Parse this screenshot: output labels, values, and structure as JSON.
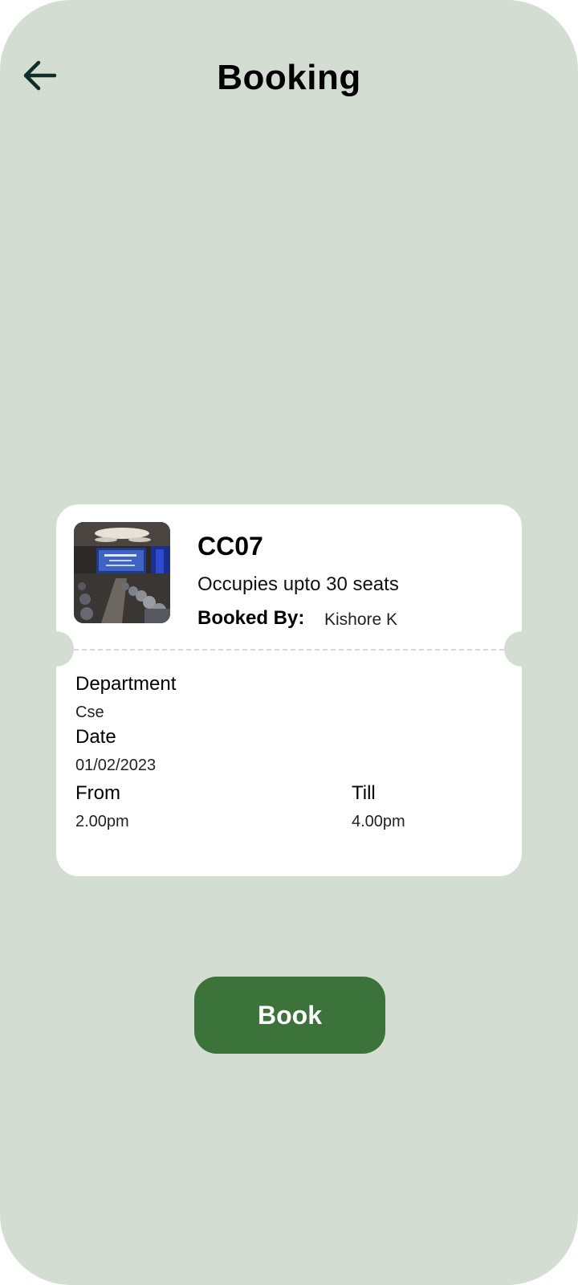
{
  "header": {
    "title": "Booking",
    "back_icon": "arrow-left-icon"
  },
  "booking_card": {
    "room_code": "CC07",
    "capacity_text": "Occupies upto 30 seats",
    "booked_by_label": "Booked By:",
    "booked_by_value": "Kishore K",
    "department_label": "Department",
    "department_value": "Cse",
    "date_label": "Date",
    "date_value": "01/02/2023",
    "from_label": "From",
    "from_value": "2.00pm",
    "till_label": "Till",
    "till_value": "4.00pm"
  },
  "actions": {
    "book_label": "Book"
  },
  "colors": {
    "background": "#d3ddd1",
    "card": "#ffffff",
    "accent": "#3b733a",
    "icon": "#0f2e2a"
  }
}
